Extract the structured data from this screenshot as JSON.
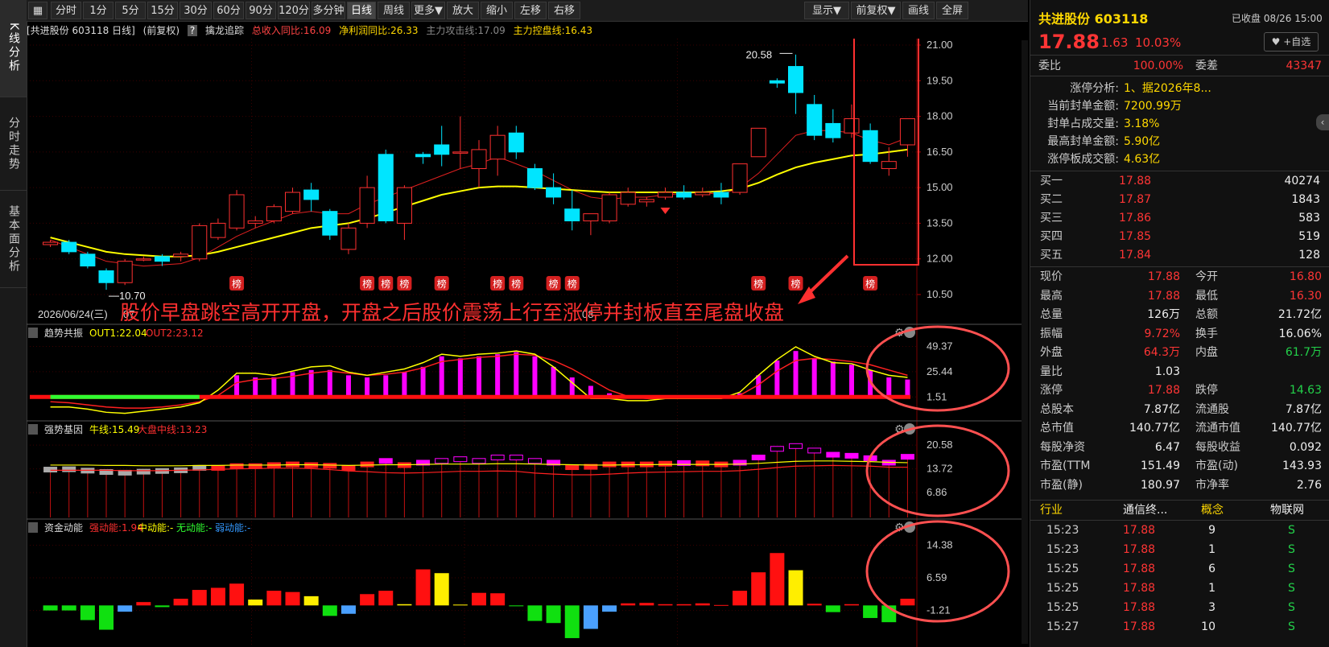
{
  "sidebar": {
    "tabs": [
      {
        "label": "K线分析"
      },
      {
        "label": "分时走势"
      },
      {
        "label": "基本面分析"
      }
    ]
  },
  "toolbar": {
    "left": [
      "分时",
      "1分",
      "5分",
      "15分",
      "30分",
      "60分",
      "90分",
      "120分",
      "多分钟",
      "日线",
      "周线",
      "更多▼",
      "放大",
      "缩小",
      "左移",
      "右移"
    ],
    "right": [
      "显示▼",
      "前复权▼",
      "画线",
      "全屏"
    ],
    "active": "日线"
  },
  "info": {
    "stock": "[共进股份 603118 日线]",
    "adjust": "(前复权)",
    "q": "?",
    "indicator": "擒龙追踪",
    "rev": "总收入同比:16.09",
    "profit": "净利润同比:26.33",
    "attack": "主力攻击线:17.09",
    "control": "主力控盘线:16.43"
  },
  "main": {
    "yticks": [
      "21.00",
      "19.50",
      "18.00",
      "16.50",
      "15.00",
      "13.50",
      "12.00",
      "10.50"
    ],
    "ytick_values": [
      21.0,
      19.5,
      18.0,
      16.5,
      15.0,
      13.5,
      12.0,
      10.5
    ],
    "date_label": "2026/06/24(三)",
    "x_mark_1": "07",
    "x_mark_2": "08",
    "high_label": "20.58",
    "low_label": "10.70",
    "bang_label": "榜",
    "annotation": "股价早盘跳空高开开盘，开盘之后股价震荡上行至涨停并封板直至尾盘收盘"
  },
  "panels": {
    "p1": {
      "title": "趋势共振",
      "out1": "OUT1:22.04",
      "out2": "OUT2:23.12",
      "ticks": [
        "49.37",
        "25.44",
        "1.51"
      ]
    },
    "p2": {
      "title": "强势基因",
      "bull": "牛线:15.49",
      "mid": "大盘中线:13.23",
      "ticks": [
        "20.58",
        "13.72",
        "6.86"
      ]
    },
    "p3": {
      "title": "资金动能",
      "strong": "强动能:1.94",
      "mid": "中动能:-",
      "none": "无动能:-",
      "weak": "弱动能:-",
      "ticks": [
        "14.38",
        "6.59",
        "-1.21"
      ]
    }
  },
  "colors": {
    "up": "#ff3030",
    "down": "#00e5ff",
    "ma_yellow": "#ffff00",
    "ma_red": "#e02020",
    "grid": "#3a0000",
    "bg": "#000000"
  },
  "chart_data": {
    "type": "candlestick",
    "ylim": [
      10.5,
      21.0
    ],
    "candles": [
      {
        "o": 12.6,
        "h": 12.8,
        "l": 12.5,
        "c": 12.7
      },
      {
        "o": 12.7,
        "h": 12.8,
        "l": 12.2,
        "c": 12.3
      },
      {
        "o": 12.2,
        "h": 12.3,
        "l": 11.6,
        "c": 11.7
      },
      {
        "o": 11.5,
        "h": 11.6,
        "l": 10.7,
        "c": 11.0
      },
      {
        "o": 11.0,
        "h": 12.0,
        "l": 10.9,
        "c": 11.9
      },
      {
        "o": 12.0,
        "h": 12.1,
        "l": 11.9,
        "c": 12.0
      },
      {
        "o": 12.1,
        "h": 12.2,
        "l": 11.7,
        "c": 11.9
      },
      {
        "o": 12.1,
        "h": 12.3,
        "l": 11.9,
        "c": 12.2
      },
      {
        "o": 12.0,
        "h": 13.5,
        "l": 11.9,
        "c": 13.4
      },
      {
        "o": 12.9,
        "h": 13.7,
        "l": 12.8,
        "c": 13.5
      },
      {
        "o": 13.3,
        "h": 14.9,
        "l": 13.2,
        "c": 14.7
      },
      {
        "o": 13.5,
        "h": 13.8,
        "l": 13.3,
        "c": 13.6
      },
      {
        "o": 13.6,
        "h": 14.3,
        "l": 13.5,
        "c": 14.2
      },
      {
        "o": 14.0,
        "h": 15.0,
        "l": 13.9,
        "c": 14.8
      },
      {
        "o": 14.9,
        "h": 15.2,
        "l": 14.0,
        "c": 14.5
      },
      {
        "o": 14.0,
        "h": 14.1,
        "l": 12.8,
        "c": 13.0
      },
      {
        "o": 12.4,
        "h": 13.5,
        "l": 12.2,
        "c": 13.3
      },
      {
        "o": 13.5,
        "h": 15.5,
        "l": 13.3,
        "c": 15.0
      },
      {
        "o": 16.4,
        "h": 16.6,
        "l": 13.5,
        "c": 13.6
      },
      {
        "o": 13.5,
        "h": 15.1,
        "l": 12.8,
        "c": 15.0
      },
      {
        "o": 16.4,
        "h": 16.5,
        "l": 16.0,
        "c": 16.3
      },
      {
        "o": 16.8,
        "h": 17.6,
        "l": 15.9,
        "c": 16.4
      },
      {
        "o": 16.5,
        "h": 18.0,
        "l": 15.8,
        "c": 16.5
      },
      {
        "o": 15.8,
        "h": 17.0,
        "l": 15.0,
        "c": 16.6
      },
      {
        "o": 16.2,
        "h": 17.6,
        "l": 15.5,
        "c": 17.2
      },
      {
        "o": 17.3,
        "h": 17.6,
        "l": 16.2,
        "c": 16.5
      },
      {
        "o": 15.8,
        "h": 16.0,
        "l": 14.9,
        "c": 15.0
      },
      {
        "o": 15.0,
        "h": 15.6,
        "l": 14.3,
        "c": 14.6
      },
      {
        "o": 14.1,
        "h": 14.9,
        "l": 13.2,
        "c": 13.6
      },
      {
        "o": 13.6,
        "h": 13.9,
        "l": 13.0,
        "c": 13.9
      },
      {
        "o": 13.6,
        "h": 14.8,
        "l": 13.5,
        "c": 14.7
      },
      {
        "o": 14.3,
        "h": 15.0,
        "l": 14.2,
        "c": 14.8
      },
      {
        "o": 14.4,
        "h": 14.6,
        "l": 14.2,
        "c": 14.5
      },
      {
        "o": 14.6,
        "h": 15.0,
        "l": 14.5,
        "c": 14.8
      },
      {
        "o": 14.8,
        "h": 15.1,
        "l": 14.5,
        "c": 14.6
      },
      {
        "o": 14.7,
        "h": 15.0,
        "l": 14.6,
        "c": 14.8
      },
      {
        "o": 14.8,
        "h": 15.2,
        "l": 14.3,
        "c": 14.6
      },
      {
        "o": 14.8,
        "h": 16.0,
        "l": 14.7,
        "c": 16.0
      },
      {
        "o": 16.3,
        "h": 17.5,
        "l": 16.3,
        "c": 17.5
      },
      {
        "o": 19.5,
        "h": 19.6,
        "l": 19.2,
        "c": 19.4
      },
      {
        "o": 20.1,
        "h": 20.6,
        "l": 18.1,
        "c": 19.0
      },
      {
        "o": 18.5,
        "h": 18.9,
        "l": 17.0,
        "c": 17.2
      },
      {
        "o": 17.7,
        "h": 18.3,
        "l": 16.9,
        "c": 17.1
      },
      {
        "o": 17.3,
        "h": 18.5,
        "l": 17.1,
        "c": 17.9
      },
      {
        "o": 17.4,
        "h": 17.7,
        "l": 16.0,
        "c": 16.1
      },
      {
        "o": 15.8,
        "h": 16.7,
        "l": 15.5,
        "c": 16.1
      },
      {
        "o": 16.8,
        "h": 17.9,
        "l": 16.3,
        "c": 17.9
      }
    ],
    "ma_yellow": [
      12.9,
      12.7,
      12.5,
      12.3,
      12.2,
      12.15,
      12.1,
      12.1,
      12.15,
      12.3,
      12.5,
      12.7,
      12.9,
      13.1,
      13.3,
      13.4,
      13.5,
      13.7,
      13.95,
      14.2,
      14.45,
      14.7,
      14.85,
      15.0,
      15.05,
      15.05,
      15.0,
      14.95,
      14.9,
      14.85,
      14.8,
      14.8,
      14.8,
      14.8,
      14.8,
      14.8,
      14.85,
      14.95,
      15.2,
      15.55,
      15.85,
      16.05,
      16.2,
      16.35,
      16.4,
      16.5,
      16.6
    ],
    "ma_red": [
      12.8,
      12.5,
      12.2,
      11.9,
      11.8,
      11.7,
      11.75,
      11.8,
      12.05,
      12.5,
      12.95,
      13.3,
      13.6,
      13.9,
      14.0,
      13.9,
      13.9,
      14.3,
      14.6,
      14.9,
      15.2,
      15.5,
      15.8,
      16.0,
      16.3,
      16.0,
      15.7,
      15.3,
      14.9,
      14.6,
      14.5,
      14.6,
      14.6,
      14.7,
      14.75,
      14.8,
      14.7,
      15.0,
      15.6,
      16.4,
      17.2,
      17.4,
      17.4,
      17.3,
      17.0,
      16.8,
      17.1
    ],
    "bang_indices": [
      10,
      17,
      18,
      19,
      21,
      24,
      25,
      27,
      28,
      38,
      40,
      44
    ],
    "p1": {
      "bars": [
        0,
        0,
        0,
        0,
        0,
        0,
        0,
        0,
        0,
        3,
        22,
        20,
        20,
        25,
        27,
        27,
        22,
        20,
        22,
        25,
        30,
        40,
        38,
        40,
        42,
        44,
        40,
        30,
        20,
        12,
        5,
        0,
        0,
        0,
        0,
        0,
        0,
        5,
        22,
        36,
        45,
        38,
        35,
        32,
        27,
        20,
        18
      ],
      "yellow": [
        -8,
        -8,
        -10,
        -13,
        -14,
        -12,
        -10,
        -8,
        -4,
        8,
        24,
        24,
        22,
        26,
        30,
        31,
        25,
        22,
        25,
        28,
        34,
        42,
        40,
        42,
        43,
        45,
        42,
        30,
        15,
        0,
        0,
        -2,
        -2,
        0,
        0,
        0,
        0,
        6,
        22,
        37,
        49,
        40,
        34,
        33,
        27,
        22,
        20
      ],
      "red": [
        -3,
        -4,
        -6,
        -8,
        -9,
        -9,
        -8,
        -6,
        -3,
        3,
        15,
        18,
        19,
        21,
        24,
        26,
        24,
        22,
        23,
        25,
        29,
        35,
        37,
        39,
        40,
        42,
        41,
        36,
        28,
        18,
        8,
        2,
        0,
        0,
        0,
        0,
        0,
        3,
        13,
        26,
        36,
        38,
        37,
        35,
        32,
        27,
        22
      ]
    },
    "p2": {
      "bars": [
        13.5,
        13.6,
        13.2,
        12.8,
        12.6,
        12.9,
        13.1,
        13.3,
        14.0,
        14.0,
        14.5,
        14.5,
        14.8,
        15.0,
        14.8,
        14.6,
        14.0,
        15.0,
        16.0,
        14.8,
        15.5,
        16.0,
        16.5,
        16.0,
        17.0,
        17.0,
        16.0,
        15.5,
        14.2,
        14.3,
        15.0,
        15.0,
        15.0,
        15.2,
        15.4,
        15.3,
        15.0,
        15.5,
        17.0,
        19.5,
        20.3,
        19.0,
        17.8,
        17.5,
        16.8,
        15.5,
        17.2
      ],
      "bull": [
        14.8,
        14.8,
        14.8,
        14.7,
        14.7,
        14.6,
        14.6,
        14.6,
        14.7,
        14.7,
        14.8,
        14.8,
        14.8,
        14.9,
        14.9,
        14.8,
        14.7,
        14.8,
        14.9,
        14.9,
        15.0,
        15.1,
        15.1,
        15.1,
        15.2,
        15.2,
        15.1,
        15.0,
        14.9,
        14.8,
        14.8,
        14.9,
        14.9,
        15.0,
        15.0,
        15.0,
        15.0,
        15.1,
        15.3,
        15.6,
        15.9,
        16.0,
        16.0,
        15.9,
        15.8,
        15.6,
        15.5
      ],
      "mid": [
        13.3,
        13.3,
        13.3,
        13.3,
        13.2,
        13.2,
        13.2,
        13.3,
        13.4,
        13.6,
        13.7,
        13.8,
        13.9,
        13.9,
        13.8,
        13.5,
        13.1,
        12.9,
        12.6,
        12.5,
        12.6,
        12.8,
        13.0,
        13.0,
        13.1,
        13.0,
        12.5,
        12.2,
        12.0,
        12.0,
        12.2,
        12.5,
        12.7,
        12.8,
        12.9,
        13.0,
        13.0,
        13.2,
        13.6,
        14.1,
        14.5,
        14.6,
        14.7,
        14.6,
        14.5,
        14.2,
        14.2
      ]
    },
    "p3": {
      "bars": [
        -1.2,
        -1.2,
        -3.5,
        -5.8,
        -1.5,
        0.8,
        -0.4,
        1.6,
        3.7,
        4.2,
        5.2,
        1.4,
        3.5,
        3.2,
        2.2,
        -2.5,
        -2.0,
        2.7,
        3.5,
        0.3,
        8.6,
        7.7,
        0.2,
        3.0,
        2.9,
        -0.2,
        -3.7,
        -4.2,
        -7.8,
        -5.6,
        -1.5,
        0.5,
        0.6,
        0.3,
        0.3,
        0.5,
        0.1,
        3.5,
        7.9,
        12.5,
        8.4,
        0.4,
        -1.6,
        0.3,
        -3.0,
        -4.0,
        1.6
      ],
      "colors": [
        "g",
        "g",
        "g",
        "g",
        "b",
        "r",
        "g",
        "r",
        "r",
        "r",
        "r",
        "y",
        "r",
        "r",
        "y",
        "g",
        "b",
        "r",
        "r",
        "y",
        "r",
        "y",
        "y",
        "r",
        "r",
        "g",
        "g",
        "g",
        "g",
        "b",
        "b",
        "r",
        "r",
        "r",
        "r",
        "r",
        "r",
        "r",
        "r",
        "r",
        "y",
        "r",
        "g",
        "r",
        "g",
        "g",
        "r"
      ]
    }
  },
  "right_panel": {
    "title": "共进股份 603118",
    "closed": "已收盘 08/26 15:00",
    "price": "17.88",
    "change": "1.63",
    "pct": "10.03%",
    "fav": "♥ +自选",
    "weibi_l": "委比",
    "weibi_v": "100.00%",
    "weicha_l": "委差",
    "weicha_v": "43347",
    "zt": [
      {
        "k": "涨停分析:",
        "v": "1、据2026年8..."
      },
      {
        "k": "当前封单金额:",
        "v": "7200.99万"
      },
      {
        "k": "封单占成交量:",
        "v": "3.18%"
      },
      {
        "k": "最高封单金额:",
        "v": "5.90亿"
      },
      {
        "k": "涨停板成交额:",
        "v": "4.63亿"
      }
    ],
    "buy": [
      {
        "l": "买一",
        "p": "17.88",
        "v": "40274"
      },
      {
        "l": "买二",
        "p": "17.87",
        "v": "1843"
      },
      {
        "l": "买三",
        "p": "17.86",
        "v": "583"
      },
      {
        "l": "买四",
        "p": "17.85",
        "v": "519"
      },
      {
        "l": "买五",
        "p": "17.84",
        "v": "128"
      }
    ],
    "stats": [
      {
        "a": "现价",
        "av": "17.88",
        "ac": "red",
        "b": "今开",
        "bv": "16.80",
        "bc": "red"
      },
      {
        "a": "最高",
        "av": "17.88",
        "ac": "red",
        "b": "最低",
        "bv": "16.30",
        "bc": "red"
      },
      {
        "a": "总量",
        "av": "126万",
        "ac": "white",
        "b": "总额",
        "bv": "21.72亿",
        "bc": "white"
      },
      {
        "a": "振幅",
        "av": "9.72%",
        "ac": "red",
        "b": "换手",
        "bv": "16.06%",
        "bc": "white"
      },
      {
        "a": "外盘",
        "av": "64.3万",
        "ac": "red",
        "b": "内盘",
        "bv": "61.7万",
        "bc": "green"
      },
      {
        "a": "量比",
        "av": "1.03",
        "ac": "white",
        "b": "",
        "bv": "",
        "bc": "white"
      },
      {
        "a": "涨停",
        "av": "17.88",
        "ac": "red",
        "b": "跌停",
        "bv": "14.63",
        "bc": "green"
      },
      {
        "a": "总股本",
        "av": "7.87亿",
        "ac": "white",
        "b": "流通股",
        "bv": "7.87亿",
        "bc": "white"
      },
      {
        "a": "总市值",
        "av": "140.77亿",
        "ac": "white",
        "b": "流通市值",
        "bv": "140.77亿",
        "bc": "white"
      },
      {
        "a": "每股净资",
        "av": "6.47",
        "ac": "white",
        "b": "每股收益",
        "bv": "0.092",
        "bc": "white"
      },
      {
        "a": "市盈(TTM",
        "av": "151.49",
        "ac": "white",
        "b": "市盈(动)",
        "bv": "143.93",
        "bc": "white"
      },
      {
        "a": "市盈(静)",
        "av": "180.97",
        "ac": "white",
        "b": "市净率",
        "bv": "2.76",
        "bc": "white"
      }
    ],
    "industry": {
      "a": "行业",
      "av": "通信终...",
      "b": "概念",
      "bv": "物联网"
    },
    "ticks": [
      {
        "t": "15:23",
        "p": "17.88",
        "v": "9",
        "s": "S"
      },
      {
        "t": "15:23",
        "p": "17.88",
        "v": "1",
        "s": "S"
      },
      {
        "t": "15:25",
        "p": "17.88",
        "v": "6",
        "s": "S"
      },
      {
        "t": "15:25",
        "p": "17.88",
        "v": "1",
        "s": "S"
      },
      {
        "t": "15:25",
        "p": "17.88",
        "v": "3",
        "s": "S"
      },
      {
        "t": "15:27",
        "p": "17.88",
        "v": "10",
        "s": "S"
      }
    ]
  }
}
